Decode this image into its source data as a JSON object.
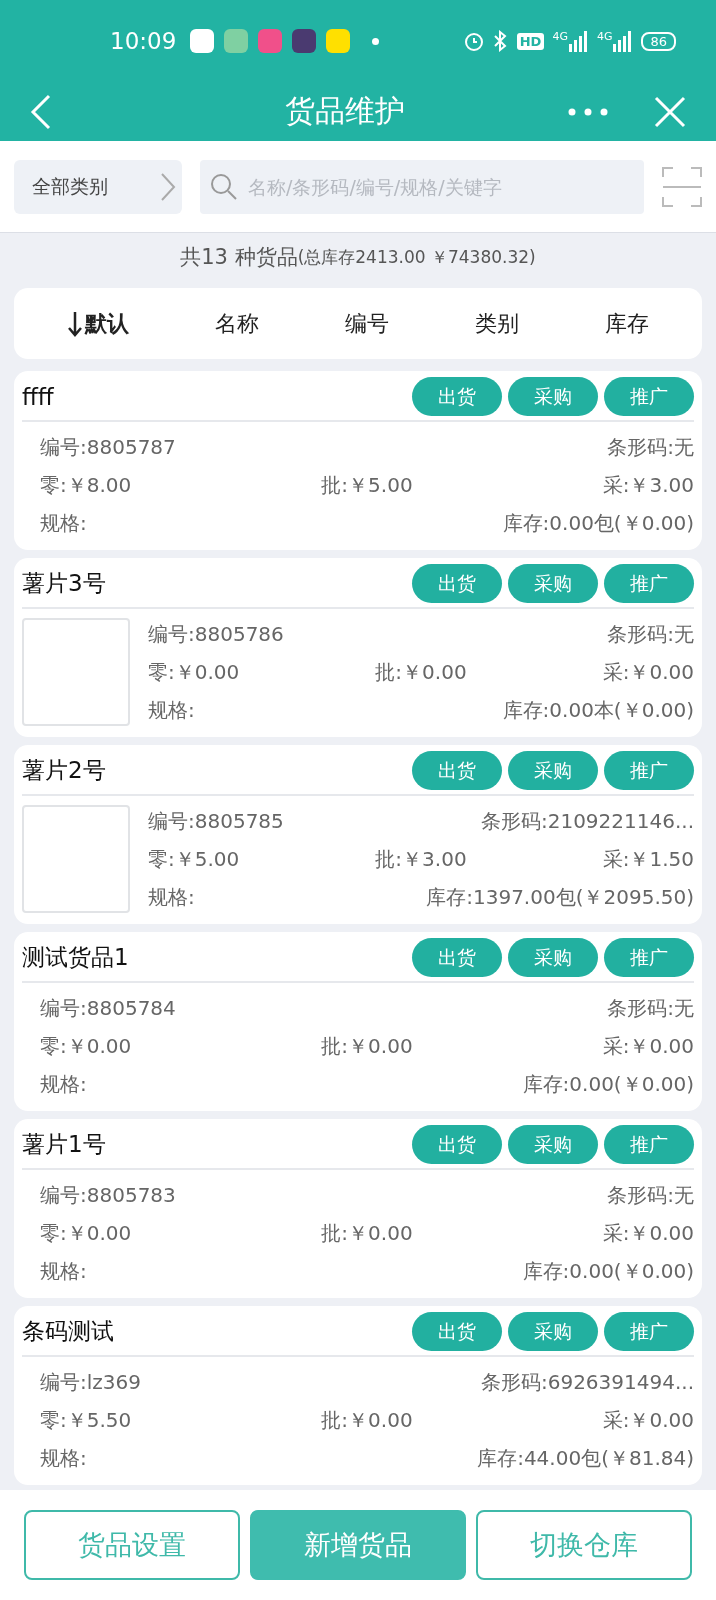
{
  "status_bar": {
    "time": "10:09",
    "battery": "86",
    "hd": "HD",
    "networks": [
      "4G",
      "4G"
    ]
  },
  "header": {
    "title": "货品维护"
  },
  "filter": {
    "category": "全部类别",
    "search_placeholder": "名称/条形码/编号/规格/关键字"
  },
  "summary": {
    "count": "共13 种货品",
    "totals": "(总库存2413.00 ￥74380.32)"
  },
  "sort_options": [
    {
      "label": "默认",
      "selected": true
    },
    {
      "label": "名称",
      "selected": false
    },
    {
      "label": "编号",
      "selected": false
    },
    {
      "label": "类别",
      "selected": false
    },
    {
      "label": "库存",
      "selected": false
    }
  ],
  "products": [
    {
      "name": "ffff",
      "kind": "plain",
      "actions": [
        "出货",
        "采购",
        "推广"
      ],
      "code": "编号:8805787",
      "barcode": "条形码:无",
      "retail": "零:￥8.00",
      "wholesale": "批:￥5.00",
      "purchase": "采:￥3.00",
      "spec": "规格:",
      "stock": "库存:0.00包(￥0.00)"
    },
    {
      "name": "薯片3号",
      "kind": "with_image",
      "actions": [
        "出货",
        "采购",
        "推广"
      ],
      "code": "编号:8805786",
      "barcode": "条形码:无",
      "retail": "零:￥0.00",
      "wholesale": "批:￥0.00",
      "purchase": "采:￥0.00",
      "spec": "规格:",
      "stock": "库存:0.00本(￥0.00)"
    },
    {
      "name": "薯片2号",
      "kind": "with_image",
      "actions": [
        "出货",
        "采购",
        "推广"
      ],
      "code": "编号:8805785",
      "barcode": "条形码:2109221146...",
      "retail": "零:￥5.00",
      "wholesale": "批:￥3.00",
      "purchase": "采:￥1.50",
      "spec": "规格:",
      "stock": "库存:1397.00包(￥2095.50)"
    },
    {
      "name": "测试货品1",
      "kind": "plain",
      "actions": [
        "出货",
        "采购",
        "推广"
      ],
      "code": "编号:8805784",
      "barcode": "条形码:无",
      "retail": "零:￥0.00",
      "wholesale": "批:￥0.00",
      "purchase": "采:￥0.00",
      "spec": "规格:",
      "stock": "库存:0.00(￥0.00)"
    },
    {
      "name": "薯片1号",
      "kind": "plain",
      "actions": [
        "出货",
        "采购",
        "推广"
      ],
      "code": "编号:8805783",
      "barcode": "条形码:无",
      "retail": "零:￥0.00",
      "wholesale": "批:￥0.00",
      "purchase": "采:￥0.00",
      "spec": "规格:",
      "stock": "库存:0.00(￥0.00)"
    },
    {
      "name": "条码测试",
      "kind": "plain",
      "actions": [
        "出货",
        "采购",
        "推广"
      ],
      "code": "编号:lz369",
      "barcode": "条形码:6926391494...",
      "retail": "零:￥5.50",
      "wholesale": "批:￥0.00",
      "purchase": "采:￥0.00",
      "spec": "规格:",
      "stock": "库存:44.00包(￥81.84)"
    }
  ],
  "bottom_buttons": [
    {
      "label": "货品设置",
      "kind": "outline"
    },
    {
      "label": "新增货品",
      "kind": "filled"
    },
    {
      "label": "切换仓库",
      "kind": "outline"
    }
  ]
}
